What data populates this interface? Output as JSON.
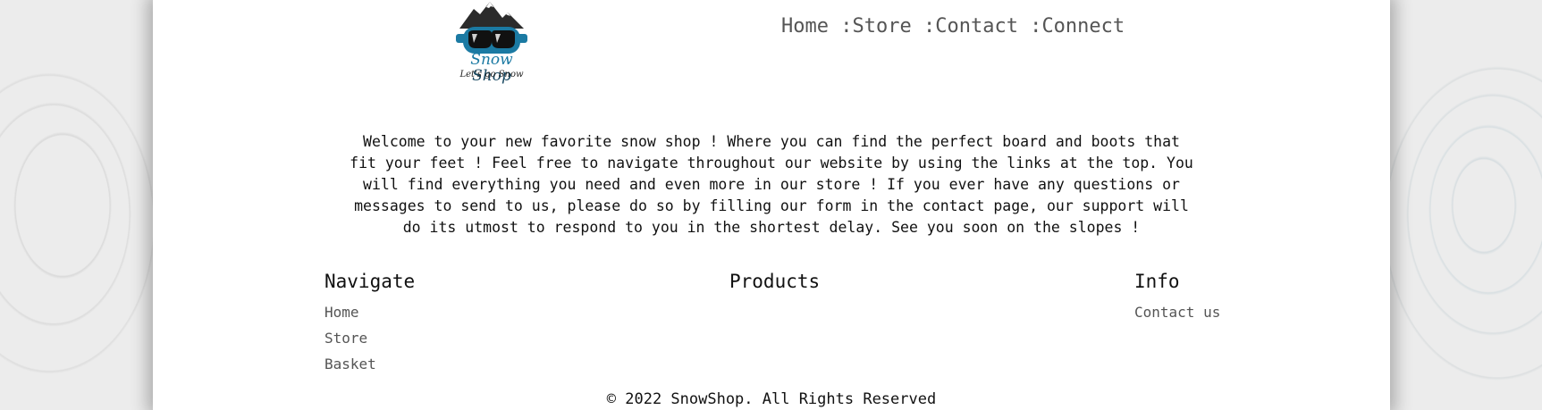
{
  "logo": {
    "brand_first": "Snow",
    "brand_second": "Shop",
    "tagline": "Let's go Snow",
    "colors": {
      "goggle_blue": "#1b7aa3",
      "mountain_dark": "#2b2b2b",
      "text_navy": "#14455e"
    }
  },
  "nav": {
    "items": [
      "Home",
      "Store",
      "Contact",
      "Connect"
    ],
    "separator": " :"
  },
  "intro": {
    "text": "Welcome to your new favorite snow shop ! Where you can find the perfect board and boots that fit your feet ! Feel free to navigate throughout our website by using the links at the top. You will find everything you need and even more in our store ! If you ever have any questions or messages to send to us, please do so by filling our form in the contact page, our support will do its utmost to respond to you in the shortest delay. See you soon on the slopes !"
  },
  "footer_columns": {
    "navigate": {
      "title": "Navigate",
      "links": [
        "Home",
        "Store",
        "Basket"
      ]
    },
    "products": {
      "title": "Products"
    },
    "info": {
      "title": "Info",
      "links": [
        "Contact us"
      ]
    }
  },
  "footer": {
    "copyright": "© 2022 SnowShop. All Rights Reserved"
  }
}
